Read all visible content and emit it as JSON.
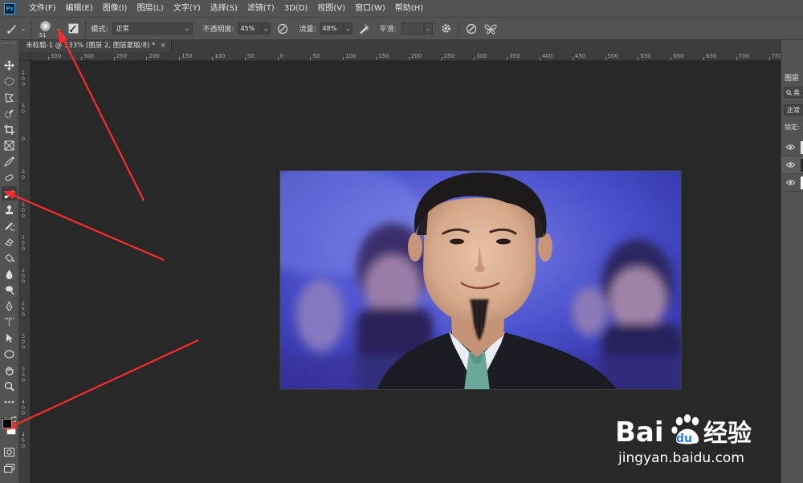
{
  "app": {
    "logo": "Ps"
  },
  "menu": [
    "文件(F)",
    "编辑(E)",
    "图像(I)",
    "图层(L)",
    "文字(Y)",
    "选择(S)",
    "滤镜(T)",
    "3D(D)",
    "视图(V)",
    "窗口(W)",
    "帮助(H)"
  ],
  "options": {
    "brush_size": "51",
    "mode_label": "模式:",
    "mode_value": "正常",
    "opacity_label": "不透明度:",
    "opacity_value": "45%",
    "flow_label": "流量:",
    "flow_value": "48%",
    "smoothing_label": "平滑:",
    "smoothing_value": ""
  },
  "document": {
    "tab_title": "未标题-1 @ 133% (图层 2, 图层蒙版/8) *",
    "close_glyph": "×"
  },
  "ruler": {
    "h_labels": [
      "350",
      "300",
      "250",
      "200",
      "150",
      "100",
      "50",
      "0",
      "50",
      "100",
      "150",
      "200",
      "250",
      "300",
      "350",
      "400",
      "450",
      "500",
      "550",
      "600",
      "650",
      "700",
      "750"
    ],
    "v_labels": [
      "1\n0\n0",
      "5\n0",
      "0",
      "5\n0",
      "1\n0\n0",
      "1\n5\n0",
      "2\n0\n0",
      "2\n5\n0",
      "3\n0\n0",
      "3\n5\n0",
      "4\n0\n0",
      "4\n5\n0"
    ]
  },
  "layers_panel": {
    "title": "图层",
    "search_prefix": "类",
    "blend_mode": "正常",
    "lock_label": "锁定:"
  },
  "watermark": {
    "brand_left": "Bai",
    "brand_right": "du",
    "brand_cn": "经验",
    "url": "jingyan.baidu.com"
  },
  "colors": {
    "ui_panel": "#535353",
    "canvas_bg": "#282828",
    "arrow": "#ff2a2a"
  }
}
